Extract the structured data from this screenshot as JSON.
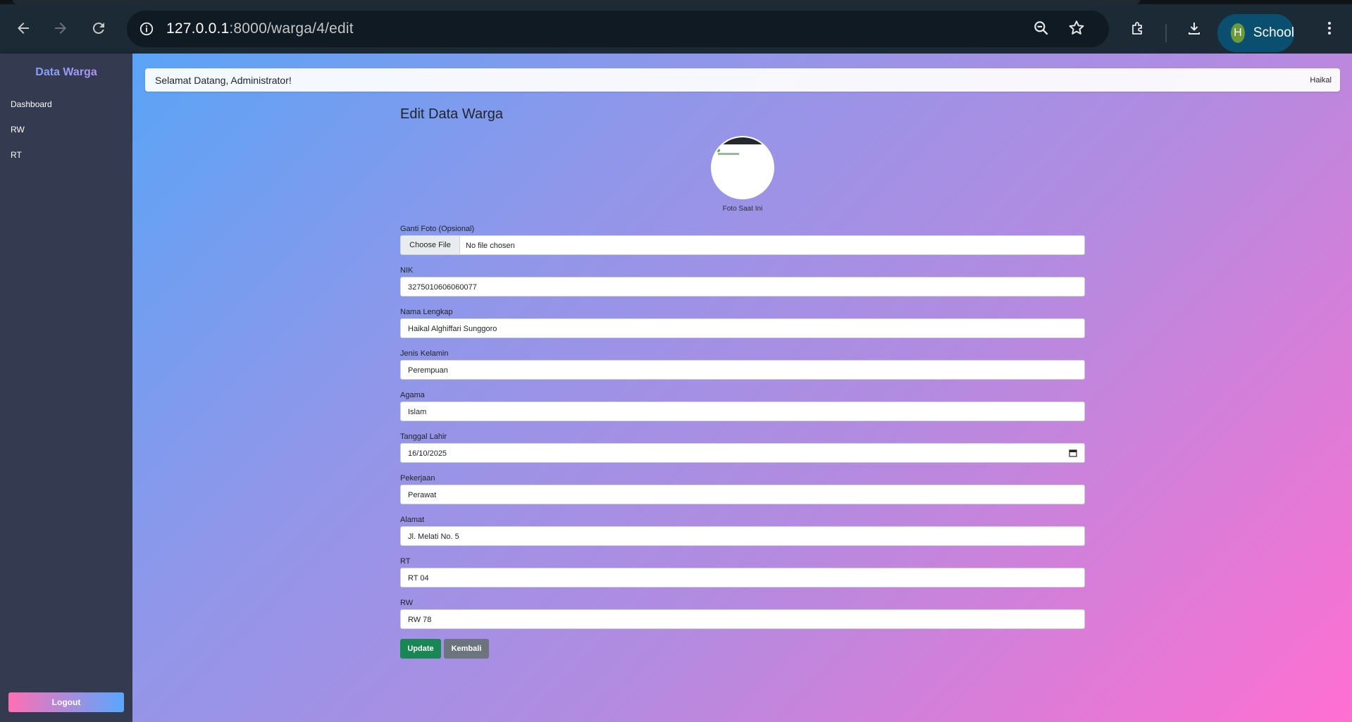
{
  "browser": {
    "url_host": "127.0.0.1",
    "url_path": ":8000/warga/4/edit",
    "profile_initial": "H",
    "profile_name": "School"
  },
  "sidebar": {
    "brand": "Data Warga",
    "items": [
      {
        "label": "Dashboard"
      },
      {
        "label": "RW"
      },
      {
        "label": "RT"
      }
    ],
    "logout_label": "Logout"
  },
  "header": {
    "welcome": "Selamat Datang, Administrator!",
    "user": "Haikal"
  },
  "form": {
    "title": "Edit Data Warga",
    "photo_caption": "Foto Saat Ini",
    "photo_label": "Ganti Foto (Opsional)",
    "file_button": "Choose File",
    "file_status": "No file chosen",
    "fields": [
      {
        "label": "NIK",
        "value": "3275010606060077"
      },
      {
        "label": "Nama Lengkap",
        "value": "Haikal Alghiffari Sunggoro"
      },
      {
        "label": "Jenis Kelamin",
        "value": "Perempuan"
      },
      {
        "label": "Agama",
        "value": "Islam"
      },
      {
        "label": "Tanggal Lahir",
        "value": "16/10/2025"
      },
      {
        "label": "Pekerjaan",
        "value": "Perawat"
      },
      {
        "label": "Alamat",
        "value": "Jl. Melati No. 5"
      },
      {
        "label": "RT",
        "value": "RT 04"
      },
      {
        "label": "RW",
        "value": "RW 78"
      }
    ],
    "update_label": "Update",
    "back_label": "Kembali"
  }
}
